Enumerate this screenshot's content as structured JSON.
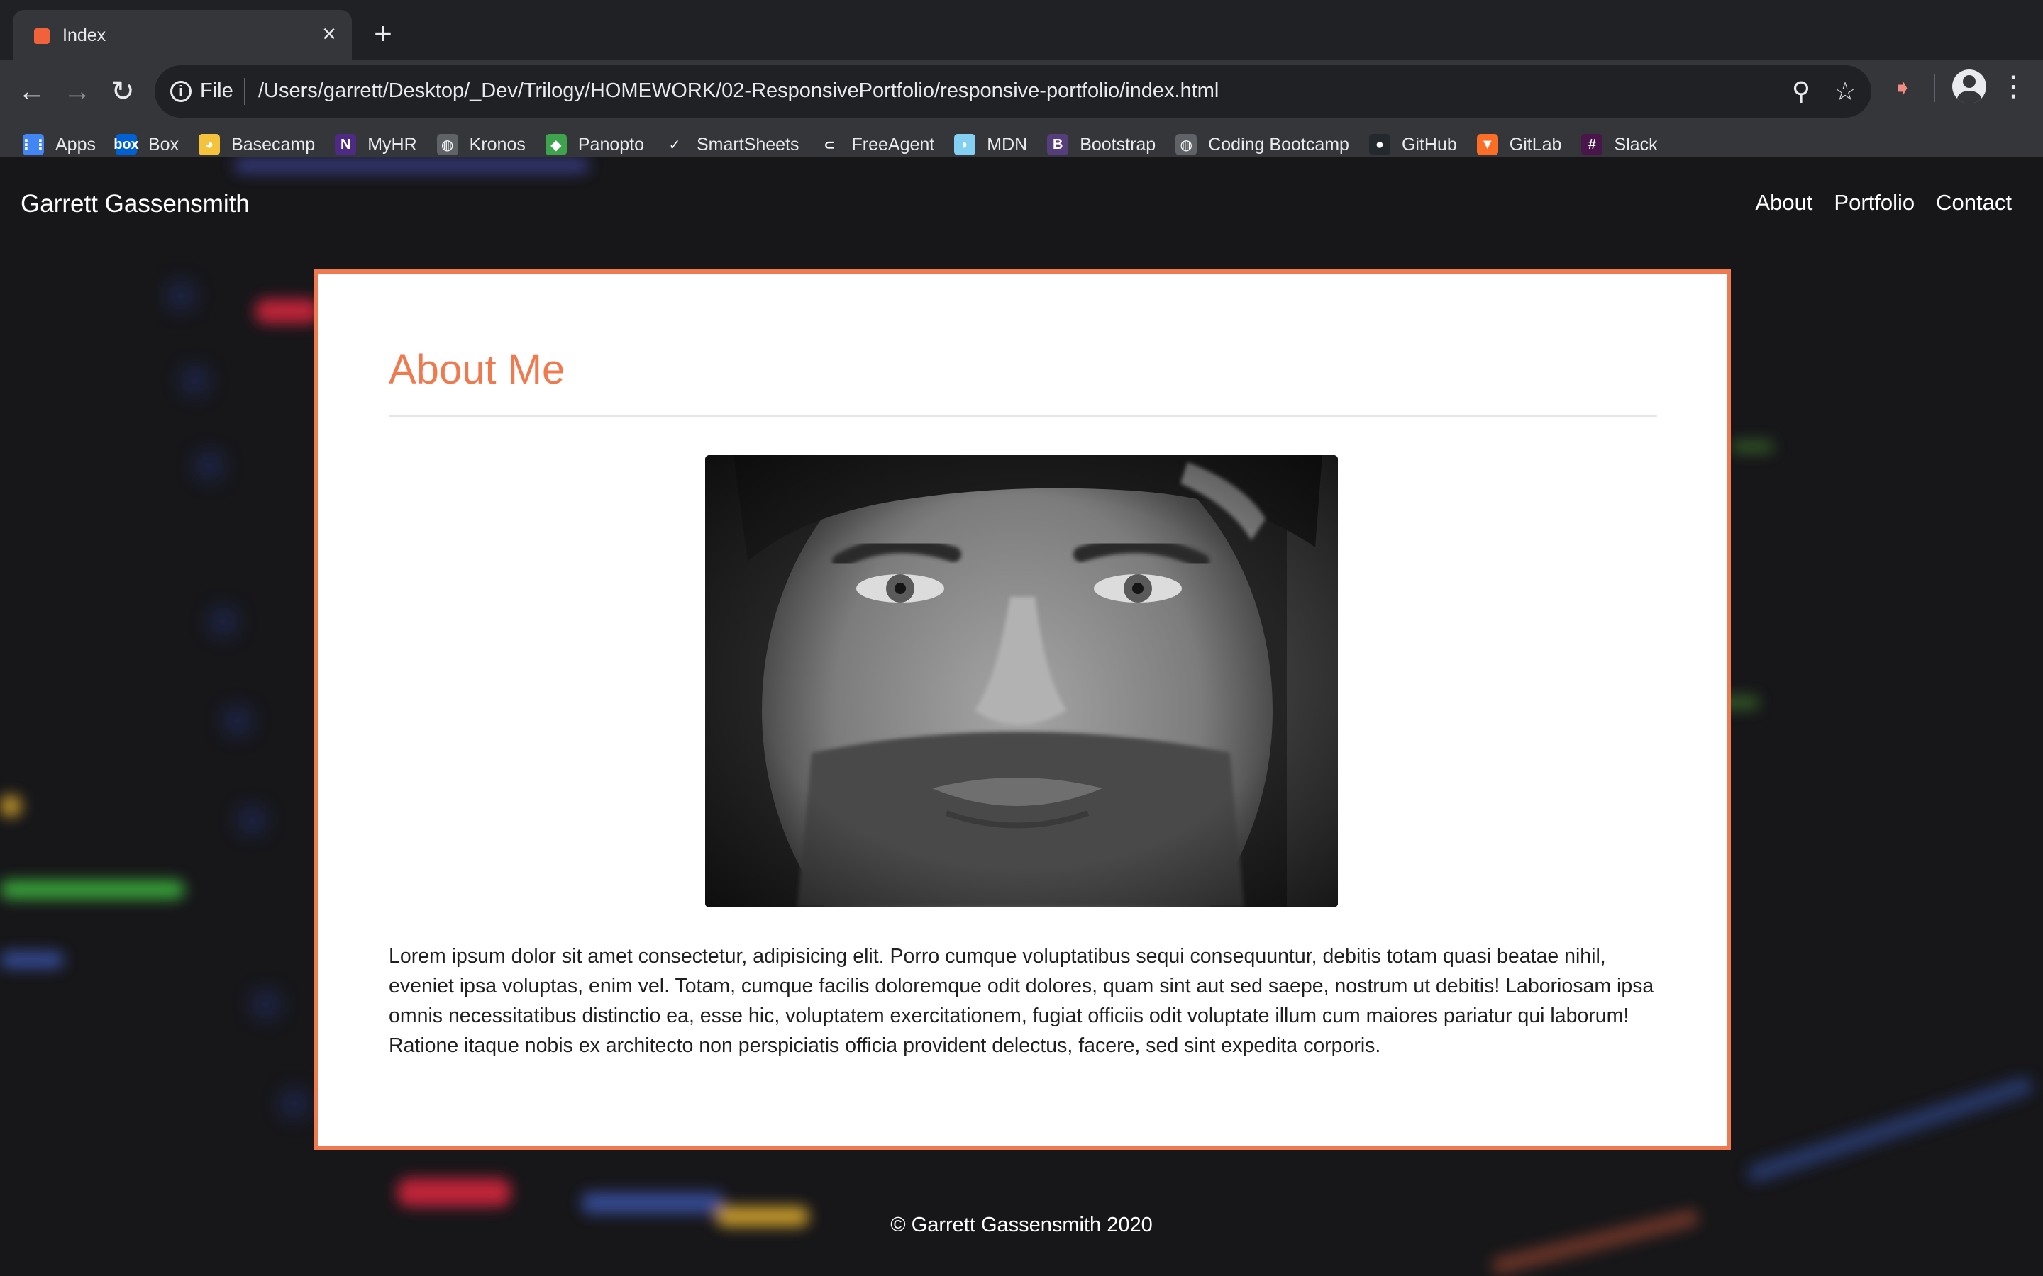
{
  "browser": {
    "tab": {
      "title": "Index",
      "close": "×"
    },
    "new_tab": "+",
    "nav": {
      "back": "←",
      "forward": "→",
      "reload": "↻"
    },
    "omnibox": {
      "info": "i",
      "scheme": "File",
      "url": "/Users/garrett/Desktop/_Dev/Trilogy/HOMEWORK/02-ResponsivePortfolio/responsive-portfolio/index.html",
      "zoom": "⚲",
      "star": "☆"
    },
    "extension": "➧",
    "menu": "⋮",
    "bookmarks": [
      {
        "label": "Apps",
        "icon": "apps-grid-icon",
        "color": "#4285f4",
        "glyph": "⋮⋮"
      },
      {
        "label": "Box",
        "icon": "box-icon",
        "color": "#0061d5",
        "glyph": "box"
      },
      {
        "label": "Basecamp",
        "icon": "basecamp-icon",
        "color": "#f5c33b",
        "glyph": "◕"
      },
      {
        "label": "MyHR",
        "icon": "myhr-icon",
        "color": "#4e2a84",
        "glyph": "N"
      },
      {
        "label": "Kronos",
        "icon": "globe-icon",
        "color": "#5f6368",
        "glyph": "◍"
      },
      {
        "label": "Panopto",
        "icon": "panopto-icon",
        "color": "#3fa34d",
        "glyph": "◆"
      },
      {
        "label": "SmartSheets",
        "icon": "smartsheet-icon",
        "color": "#35363a",
        "glyph": "✓"
      },
      {
        "label": "FreeAgent",
        "icon": "freeagent-icon",
        "color": "#35363a",
        "glyph": "⊂"
      },
      {
        "label": "MDN",
        "icon": "mdn-icon",
        "color": "#83d0f2",
        "glyph": "◗"
      },
      {
        "label": "Bootstrap",
        "icon": "bootstrap-icon",
        "color": "#563d7c",
        "glyph": "B"
      },
      {
        "label": "Coding Bootcamp",
        "icon": "globe-icon",
        "color": "#5f6368",
        "glyph": "◍"
      },
      {
        "label": "GitHub",
        "icon": "github-icon",
        "color": "#24292e",
        "glyph": "●"
      },
      {
        "label": "GitLab",
        "icon": "gitlab-icon",
        "color": "#fc6d26",
        "glyph": "▼"
      },
      {
        "label": "Slack",
        "icon": "slack-icon",
        "color": "#4a154b",
        "glyph": "#"
      }
    ]
  },
  "site": {
    "brand": "Garrett Gassensmith",
    "nav": [
      "About",
      "Portfolio",
      "Contact"
    ],
    "about": {
      "title": "About Me",
      "body": "Lorem ipsum dolor sit amet consectetur, adipisicing elit. Porro cumque voluptatibus sequi consequuntur, debitis totam quasi beatae nihil, eveniet ipsa voluptas, enim vel. Totam, cumque facilis doloremque odit dolores, quam sint aut sed saepe, nostrum ut debitis! Laboriosam ipsa omnis necessitatibus distinctio ea, esse hic, voluptatem exercitationem, fugiat officiis odit voluptate illum cum maiores pariatur qui laborum! Ratione itaque nobis ex architecto non perspiciatis officia provident delectus, facere, sed sint expedita corporis."
    },
    "footer": "© Garrett Gassensmith 2020"
  },
  "colors": {
    "accent": "#f07a4f",
    "chrome_dark": "#202124",
    "chrome_toolbar": "#35363a",
    "page_bg": "#17171a"
  }
}
